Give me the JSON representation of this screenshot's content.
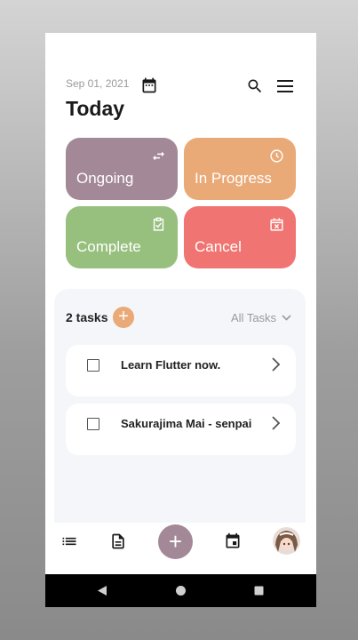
{
  "header": {
    "date": "Sep 01, 2021",
    "title": "Today"
  },
  "status_cards": [
    {
      "label": "Ongoing",
      "icon": "swap-arrows-icon",
      "color": "#a38897"
    },
    {
      "label": "In Progress",
      "icon": "clock-icon",
      "color": "#e9aa78"
    },
    {
      "label": "Complete",
      "icon": "clipboard-check-icon",
      "color": "#97bf7e"
    },
    {
      "label": "Cancel",
      "icon": "calendar-x-icon",
      "color": "#f07471"
    }
  ],
  "tasks_section": {
    "count_label": "2 tasks",
    "add_label": "+",
    "filter_label": "All Tasks",
    "items": [
      {
        "title": "Learn Flutter now."
      },
      {
        "title": "Sakurajima Mai - senpai"
      }
    ]
  },
  "bottom_nav": {
    "fab_label": "+",
    "items": [
      "list-icon",
      "document-icon",
      "add-button",
      "calendar-icon",
      "avatar"
    ]
  },
  "colors": {
    "accent": "#a38897",
    "panel_bg": "#f5f6fa"
  }
}
